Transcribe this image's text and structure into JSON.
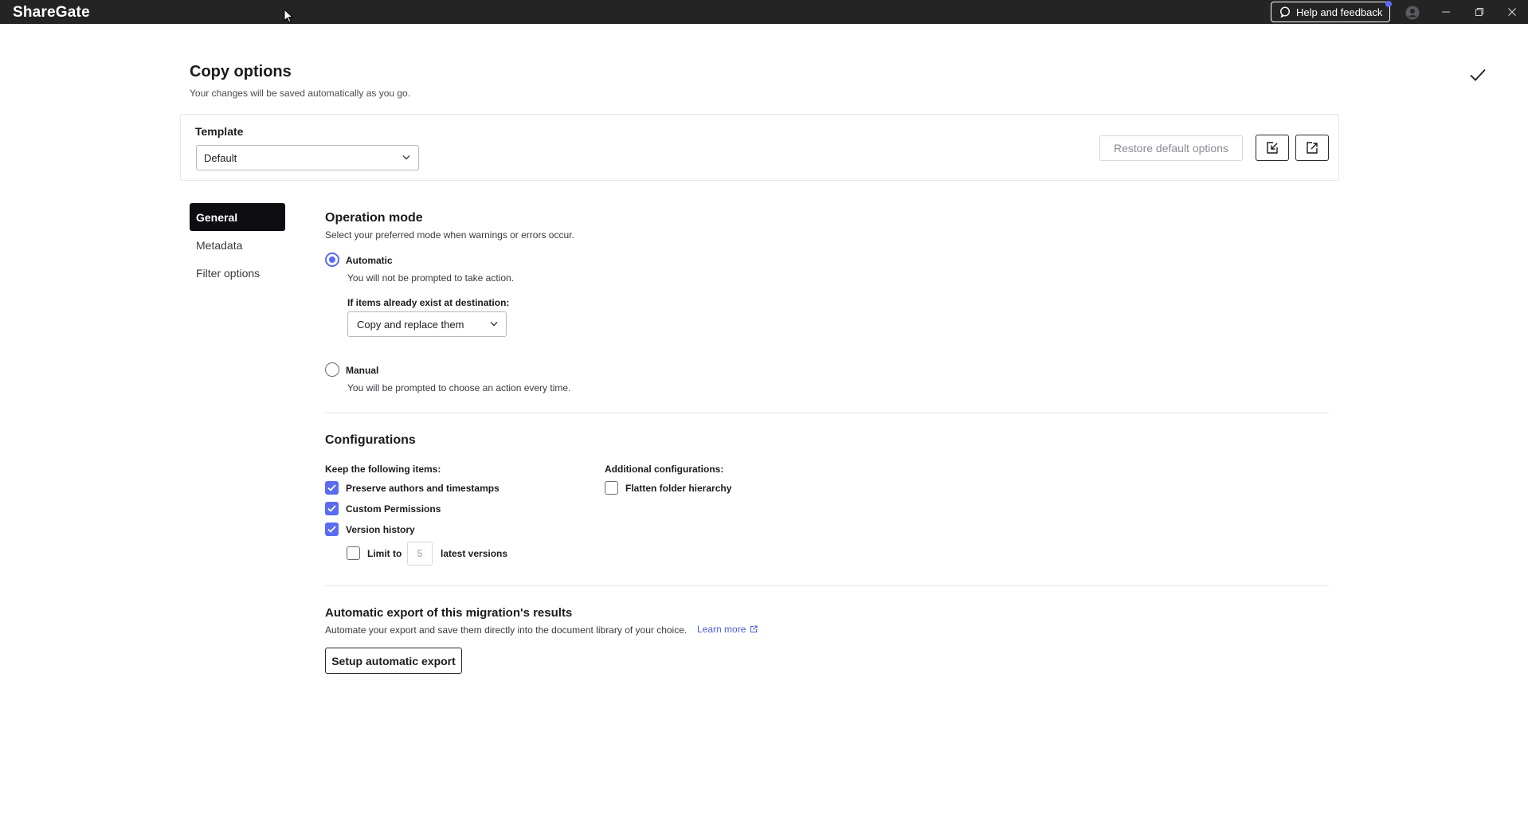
{
  "app": {
    "brand": "ShareGate",
    "help_label": "Help and feedback"
  },
  "header": {
    "title": "Copy options",
    "subtitle": "Your changes will be saved automatically as you go."
  },
  "template": {
    "label": "Template",
    "selected": "Default",
    "restore_label": "Restore default options"
  },
  "nav": {
    "items": [
      {
        "label": "General",
        "active": true
      },
      {
        "label": "Metadata",
        "active": false
      },
      {
        "label": "Filter options",
        "active": false
      }
    ]
  },
  "operation_mode": {
    "title": "Operation mode",
    "description": "Select your preferred mode when warnings or errors occur.",
    "automatic": {
      "label": "Automatic",
      "description": "You will not be prompted to take action.",
      "checked": true
    },
    "exists_label": "If items already exist at destination:",
    "exists_selected": "Copy and replace them",
    "manual": {
      "label": "Manual",
      "description": "You will be prompted to choose an action every time.",
      "checked": false
    }
  },
  "configurations": {
    "title": "Configurations",
    "keep_label": "Keep the following items:",
    "keep_items": [
      {
        "label": "Preserve authors and timestamps",
        "checked": true
      },
      {
        "label": "Custom Permissions",
        "checked": true
      },
      {
        "label": "Version history",
        "checked": true
      }
    ],
    "limit": {
      "prefix": "Limit to",
      "value": "5",
      "suffix": "latest versions",
      "checked": false
    },
    "additional_label": "Additional configurations:",
    "additional_items": [
      {
        "label": "Flatten folder hierarchy",
        "checked": false
      }
    ]
  },
  "export": {
    "title": "Automatic export of this migration's results",
    "description": "Automate your export and save them directly into the document library of your choice.",
    "learn_more": "Learn more",
    "button_label": "Setup automatic export"
  },
  "colors": {
    "accent": "#5b6cf0",
    "titlebar": "#242424",
    "link": "#4a5cd6"
  }
}
